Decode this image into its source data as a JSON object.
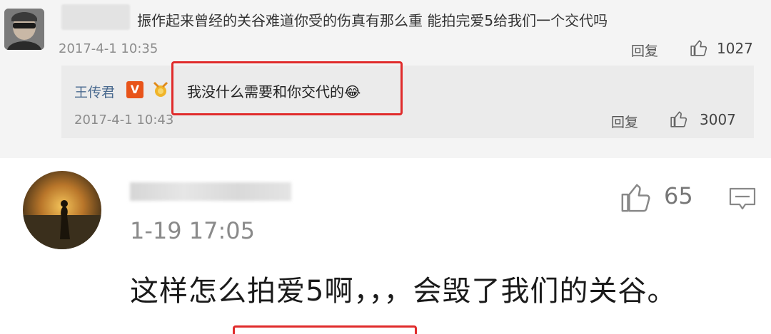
{
  "comment_top": {
    "text": "振作起来曾经的关谷难道你受的伤真有那么重 能拍完爱5给我们一个交代吗",
    "timestamp": "2017-4-1 10:35",
    "reply_label": "回复",
    "like_count": "1027"
  },
  "reply": {
    "author": "王传君",
    "badge": "V",
    "text": "我没什么需要和你交代的😂",
    "timestamp": "2017-4-1 10:43",
    "reply_label": "回复",
    "like_count": "3007"
  },
  "comment_bottom": {
    "timestamp": "1-19 17:05",
    "like_count": "65",
    "text": "这样怎么拍爱5啊，，，会毁了我们的关谷。"
  },
  "colors": {
    "highlight": "#e02b2b",
    "author_link": "#4a6a8f",
    "vip_badge": "#e8541a"
  },
  "icons": [
    "thumbs-up-icon",
    "comment-icon",
    "vip-badge-icon",
    "medal-icon"
  ]
}
